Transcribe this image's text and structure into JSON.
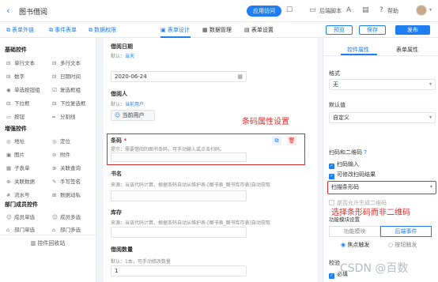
{
  "header": {
    "back_icon": "chevron-left-icon",
    "title": "图书借阅",
    "visit_button": "应用访问",
    "script_label": "后端脚本",
    "help_label": "帮助"
  },
  "toolbar": {
    "left_items": [
      "表单外链",
      "事件表单",
      "数据权限"
    ],
    "center_tabs": [
      "表单设计",
      "数据管理",
      "表单设置"
    ],
    "active_tab": "表单设计",
    "preview": "预览",
    "save": "保存",
    "publish": "发布"
  },
  "left_panel": {
    "basic_title": "基础控件",
    "basic": [
      [
        "单行文本",
        "多行文本"
      ],
      [
        "数字",
        "日期时间"
      ],
      [
        "单选按钮组",
        "复选框组"
      ],
      [
        "下拉框",
        "下拉复选框"
      ],
      [
        "按钮",
        "分割线"
      ]
    ],
    "enhanced_title": "增强控件",
    "enhanced": [
      [
        "地址",
        "定位"
      ],
      [
        "图片",
        "附件"
      ],
      [
        "子表单",
        "关联查询"
      ],
      [
        "关联数据",
        "手写签名"
      ],
      [
        "流水号",
        "数据动私"
      ]
    ],
    "dept_title": "部门成员控件",
    "dept": [
      [
        "成员单选",
        "成员多选"
      ],
      [
        "部门单选",
        "部门多选"
      ]
    ],
    "recycle": "控件回收站"
  },
  "form": {
    "f1_label": "借阅日期",
    "f1_desc_prefix": "默认：",
    "f1_desc_link": "当天",
    "f1_value": "2020-06-24",
    "f2_label": "借阅人",
    "f2_desc_prefix": "默认：",
    "f2_desc_link": "当前用户",
    "f2_value": "当前用户",
    "f3_label": "条码",
    "f3_required": "*",
    "f3_desc": "提示：需要借阅的图书条码，可手动输入或点击扫码。",
    "f4_label": "书名",
    "f4_desc": "来源：当该代码计算，根据条码自动从维护表-[图书表_图书库存表]自动获取",
    "f5_label": "库存",
    "f5_desc": "来源：当该代码计算，根据条码自动从维护表-[图书表_图书库存表]自动获取",
    "f6_label": "借阅数量",
    "f6_desc": "默认：1本，可手动修改数量",
    "f6_value": "1"
  },
  "right_panel": {
    "tabs": [
      "控件属性",
      "表单属性"
    ],
    "format_label": "格式",
    "format_value": "无",
    "default_label": "默认值",
    "default_value": "自定义",
    "scan_title": "扫码和二维码",
    "scan_input": "扫码输入",
    "allow_modify": "可修改扫码结果",
    "scan_select": "扫描条形码",
    "allow_qr": "是否允许生成二维码",
    "func_title": "功能模块设置",
    "func_btn1": "功能模块",
    "func_btn2": "后端事件",
    "radio1": "焦点触发",
    "radio2": "按钮触发",
    "verify": "校验",
    "required": "必填"
  },
  "annotations": {
    "a1": "条码属性设置",
    "a2": "选择条形码而非二维码"
  },
  "watermark": "CSDN @百数",
  "colors": {
    "accent": "#1e7ef2",
    "annotation": "#e02b2b"
  }
}
